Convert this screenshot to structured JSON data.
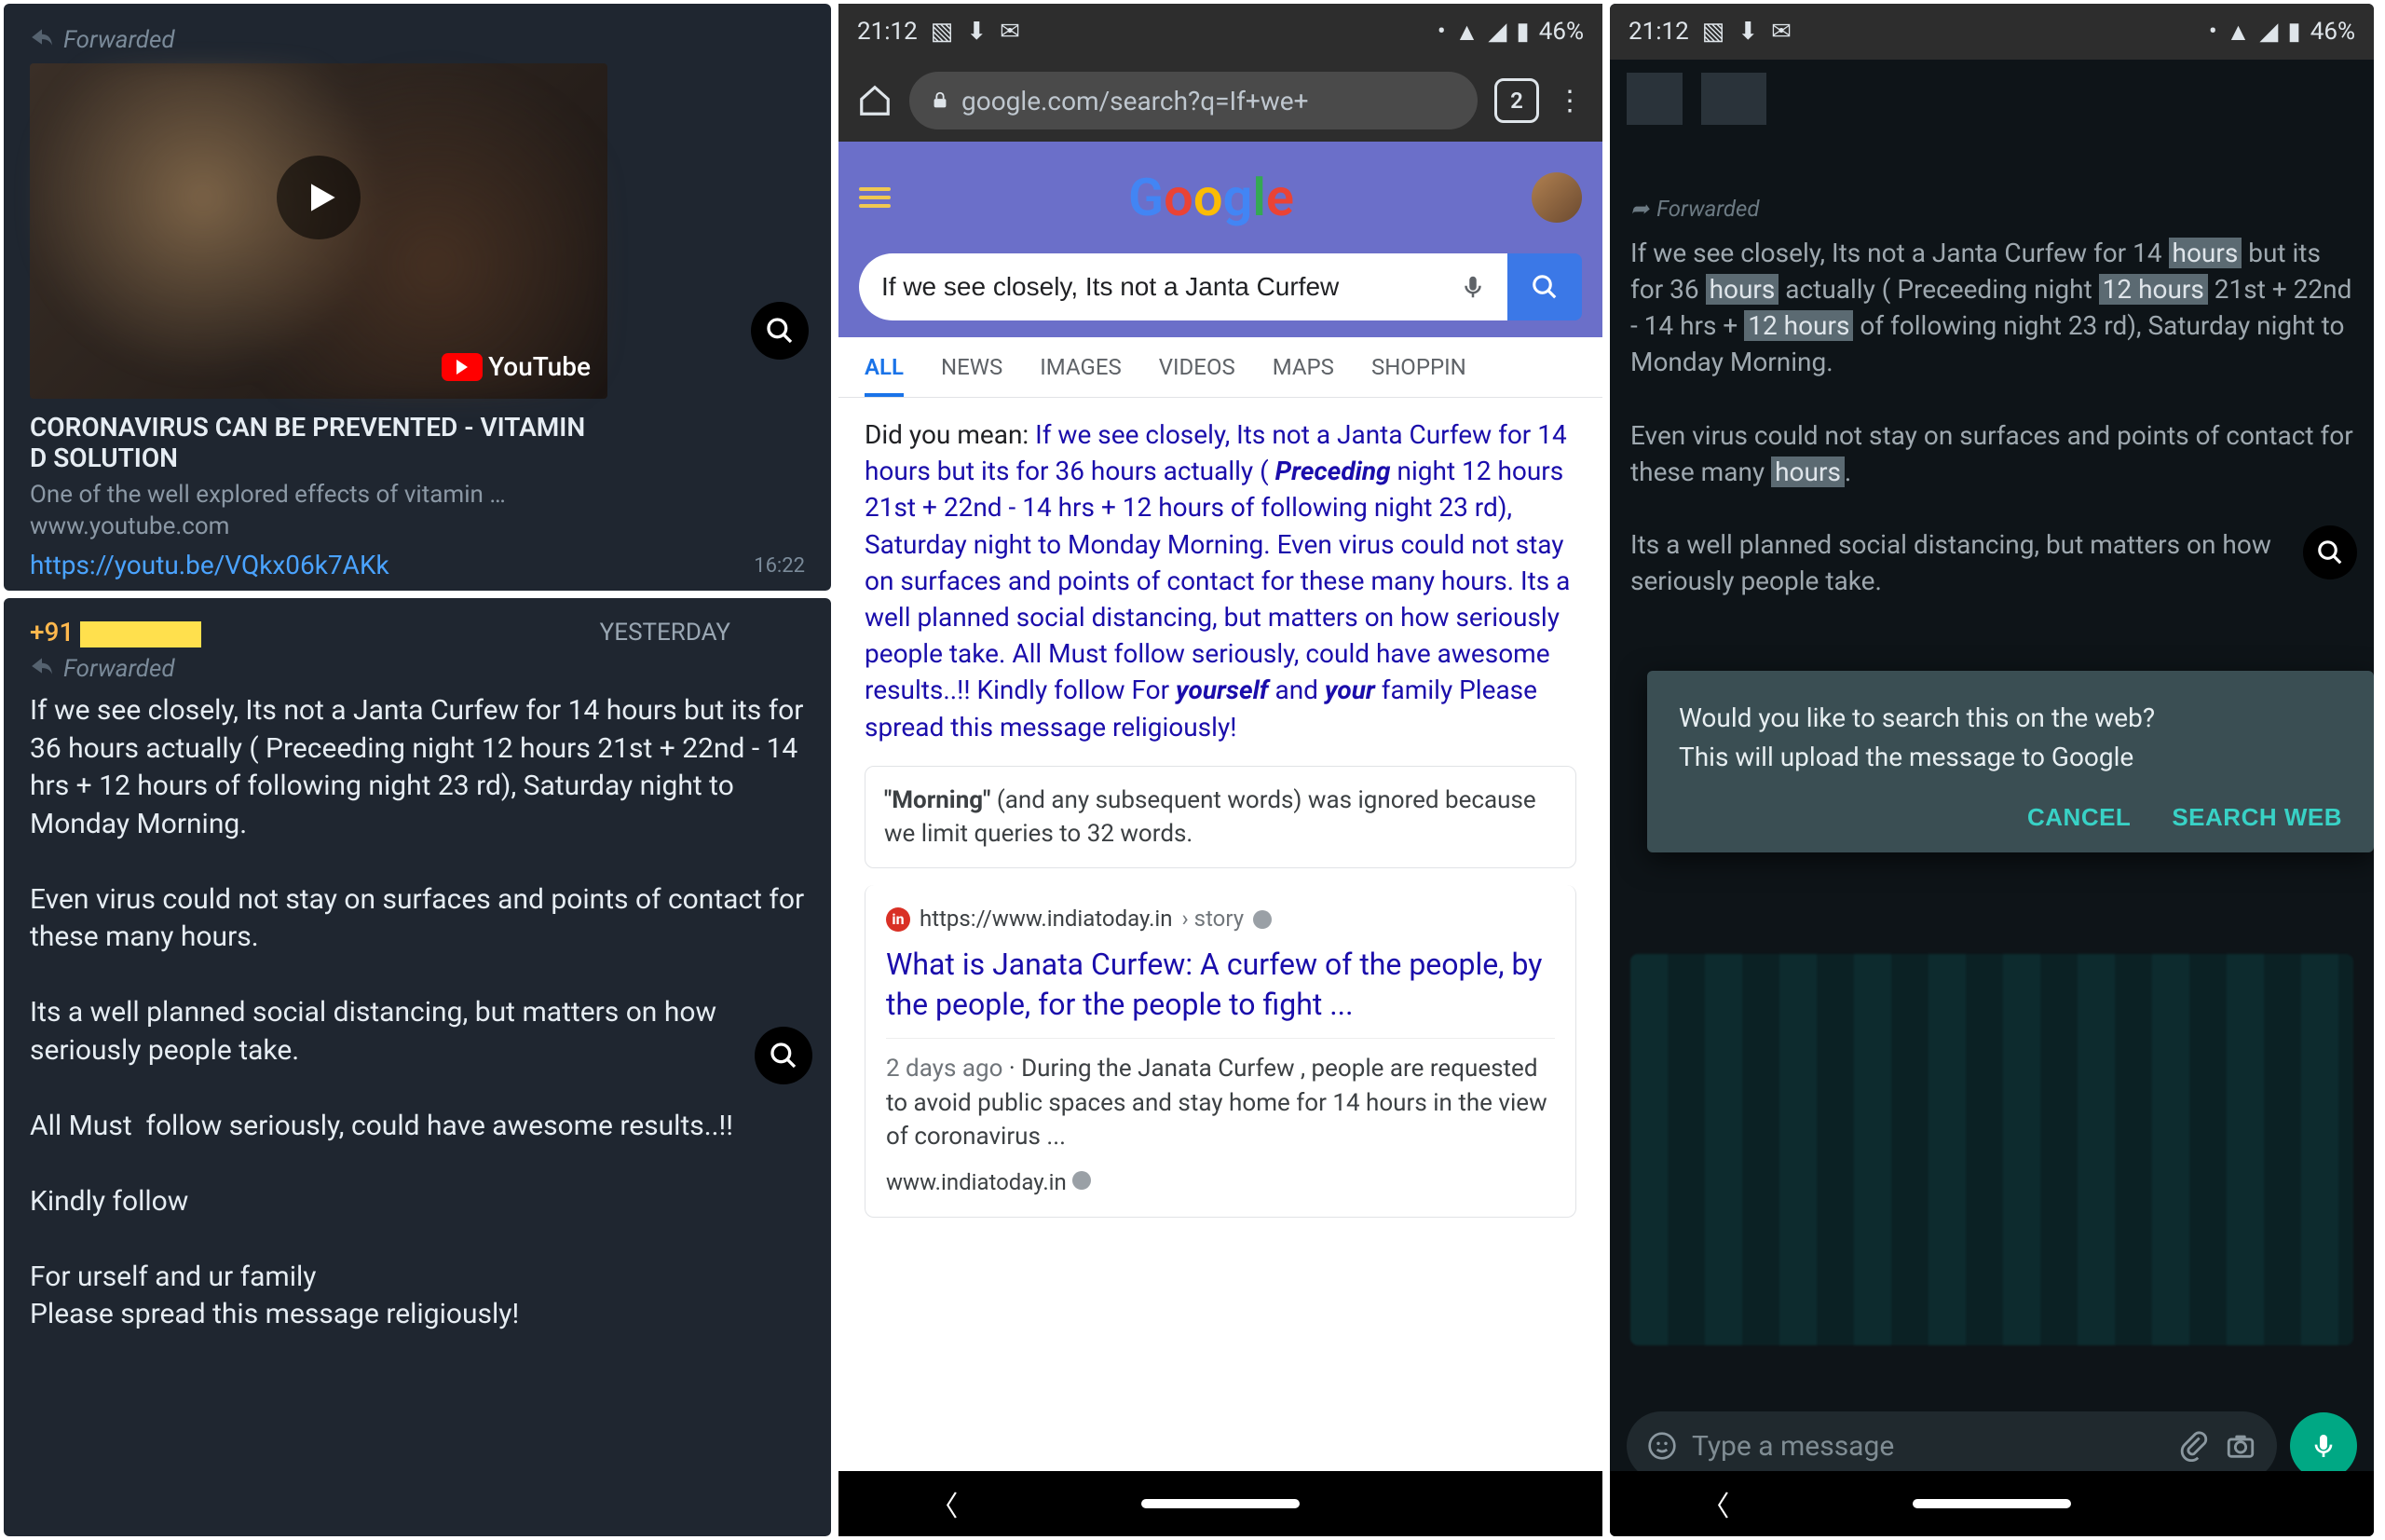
{
  "status": {
    "time": "21:12",
    "battery": "46%"
  },
  "panelA": {
    "forwarded": "Forwarded",
    "ytLabel": "YouTube",
    "title": "CORONAVIRUS CAN BE PREVENTED - VITAMIN D SOLUTION",
    "desc": "One of the well explored effects of vitamin …",
    "source": "www.youtube.com",
    "link": "https://youtu.be/VQkx06k7AKk",
    "time": "16:22"
  },
  "panelB": {
    "senderPrefix": "+91",
    "dateLabel": "YESTERDAY",
    "forwarded": "Forwarded",
    "message": "If we see closely, Its not a Janta Curfew for 14 hours but its for 36 hours actually ( Preceeding night 12 hours 21st + 22nd - 14 hrs + 12 hours of following night 23 rd), Saturday night to Monday Morning.\n\nEven virus could not stay on surfaces and points of contact for these many hours.\n\nIts a well planned social distancing, but matters on how seriously people take.\n\nAll Must  follow seriously, could have awesome results..!!\n\nKindly follow\n\nFor urself and ur family\nPlease spread this message religiously!"
  },
  "panelC": {
    "url": "google.com/search?q=If+we+",
    "tabCount": "2",
    "query": "If we see closely, Its not a Janta Curfew",
    "tabs": {
      "all": "ALL",
      "news": "NEWS",
      "images": "IMAGES",
      "videos": "VIDEOS",
      "maps": "MAPS",
      "shopping": "SHOPPIN"
    },
    "dymLabel": "Did you mean: ",
    "dymPrefix": "If we see closely, Its not a Janta Curfew for 14 hours but its for 36 hours actually ( ",
    "dymItalic1": "Preceding",
    "dymMiddle": " night 12 hours 21st + 22nd - 14 hrs + 12 hours of following night 23 rd), Saturday night to Monday Morning. Even virus could not stay on surfaces and points of contact for these many hours. Its a well planned social distancing, but matters on how seriously people take. All Must follow seriously, could have awesome results..!! Kindly follow For ",
    "dymItalic2": "yourself",
    "dymAnd": " and ",
    "dymItalic3": "your",
    "dymSuffix": " family Please spread this message religiously!",
    "noticeBold": "\"Morning\"",
    "noticeRest": " (and any subsequent words) was ignored because we limit queries to 32 words.",
    "result": {
      "srcUrl": "https://www.indiatoday.in",
      "srcPath": " › story",
      "title": "What is Janata Curfew: A curfew of the people, by the people, for the people to fight ...",
      "age": "2 days ago",
      "snippet": " · During the Janata Curfew , people are requested to avoid public spaces and stay home for 14 hours in the view of coronavirus ...",
      "cite": "www.indiatoday.in"
    }
  },
  "panelD": {
    "forwarded": "Forwarded",
    "msgLine1a": "If we see closely, Its not a Janta Curfew for 14 ",
    "hl1": "hours",
    "msgLine1b": " but its for 36 ",
    "hl2": "hours",
    "msgLine1c": " actually ( Preceeding night ",
    "hl3": "12 hours",
    "msgLine1d": " 21st + 22nd - 14 hrs + ",
    "hl4": "12 hours",
    "msgLine1e": " of following night 23 rd), Saturday night to Monday Morning.",
    "msgPara2a": "Even virus could not stay on surfaces and points of contact for these many ",
    "hl5": "hours",
    "msgPara2b": ".",
    "msgPara3": "Its a well planned social distancing, but matters on how seriously people take.",
    "dialogLine1": "Would you like to search this on the web?",
    "dialogLine2": "This will upload the message to Google",
    "cancel": "CANCEL",
    "searchWeb": "SEARCH WEB",
    "placeholder": "Type a message"
  }
}
